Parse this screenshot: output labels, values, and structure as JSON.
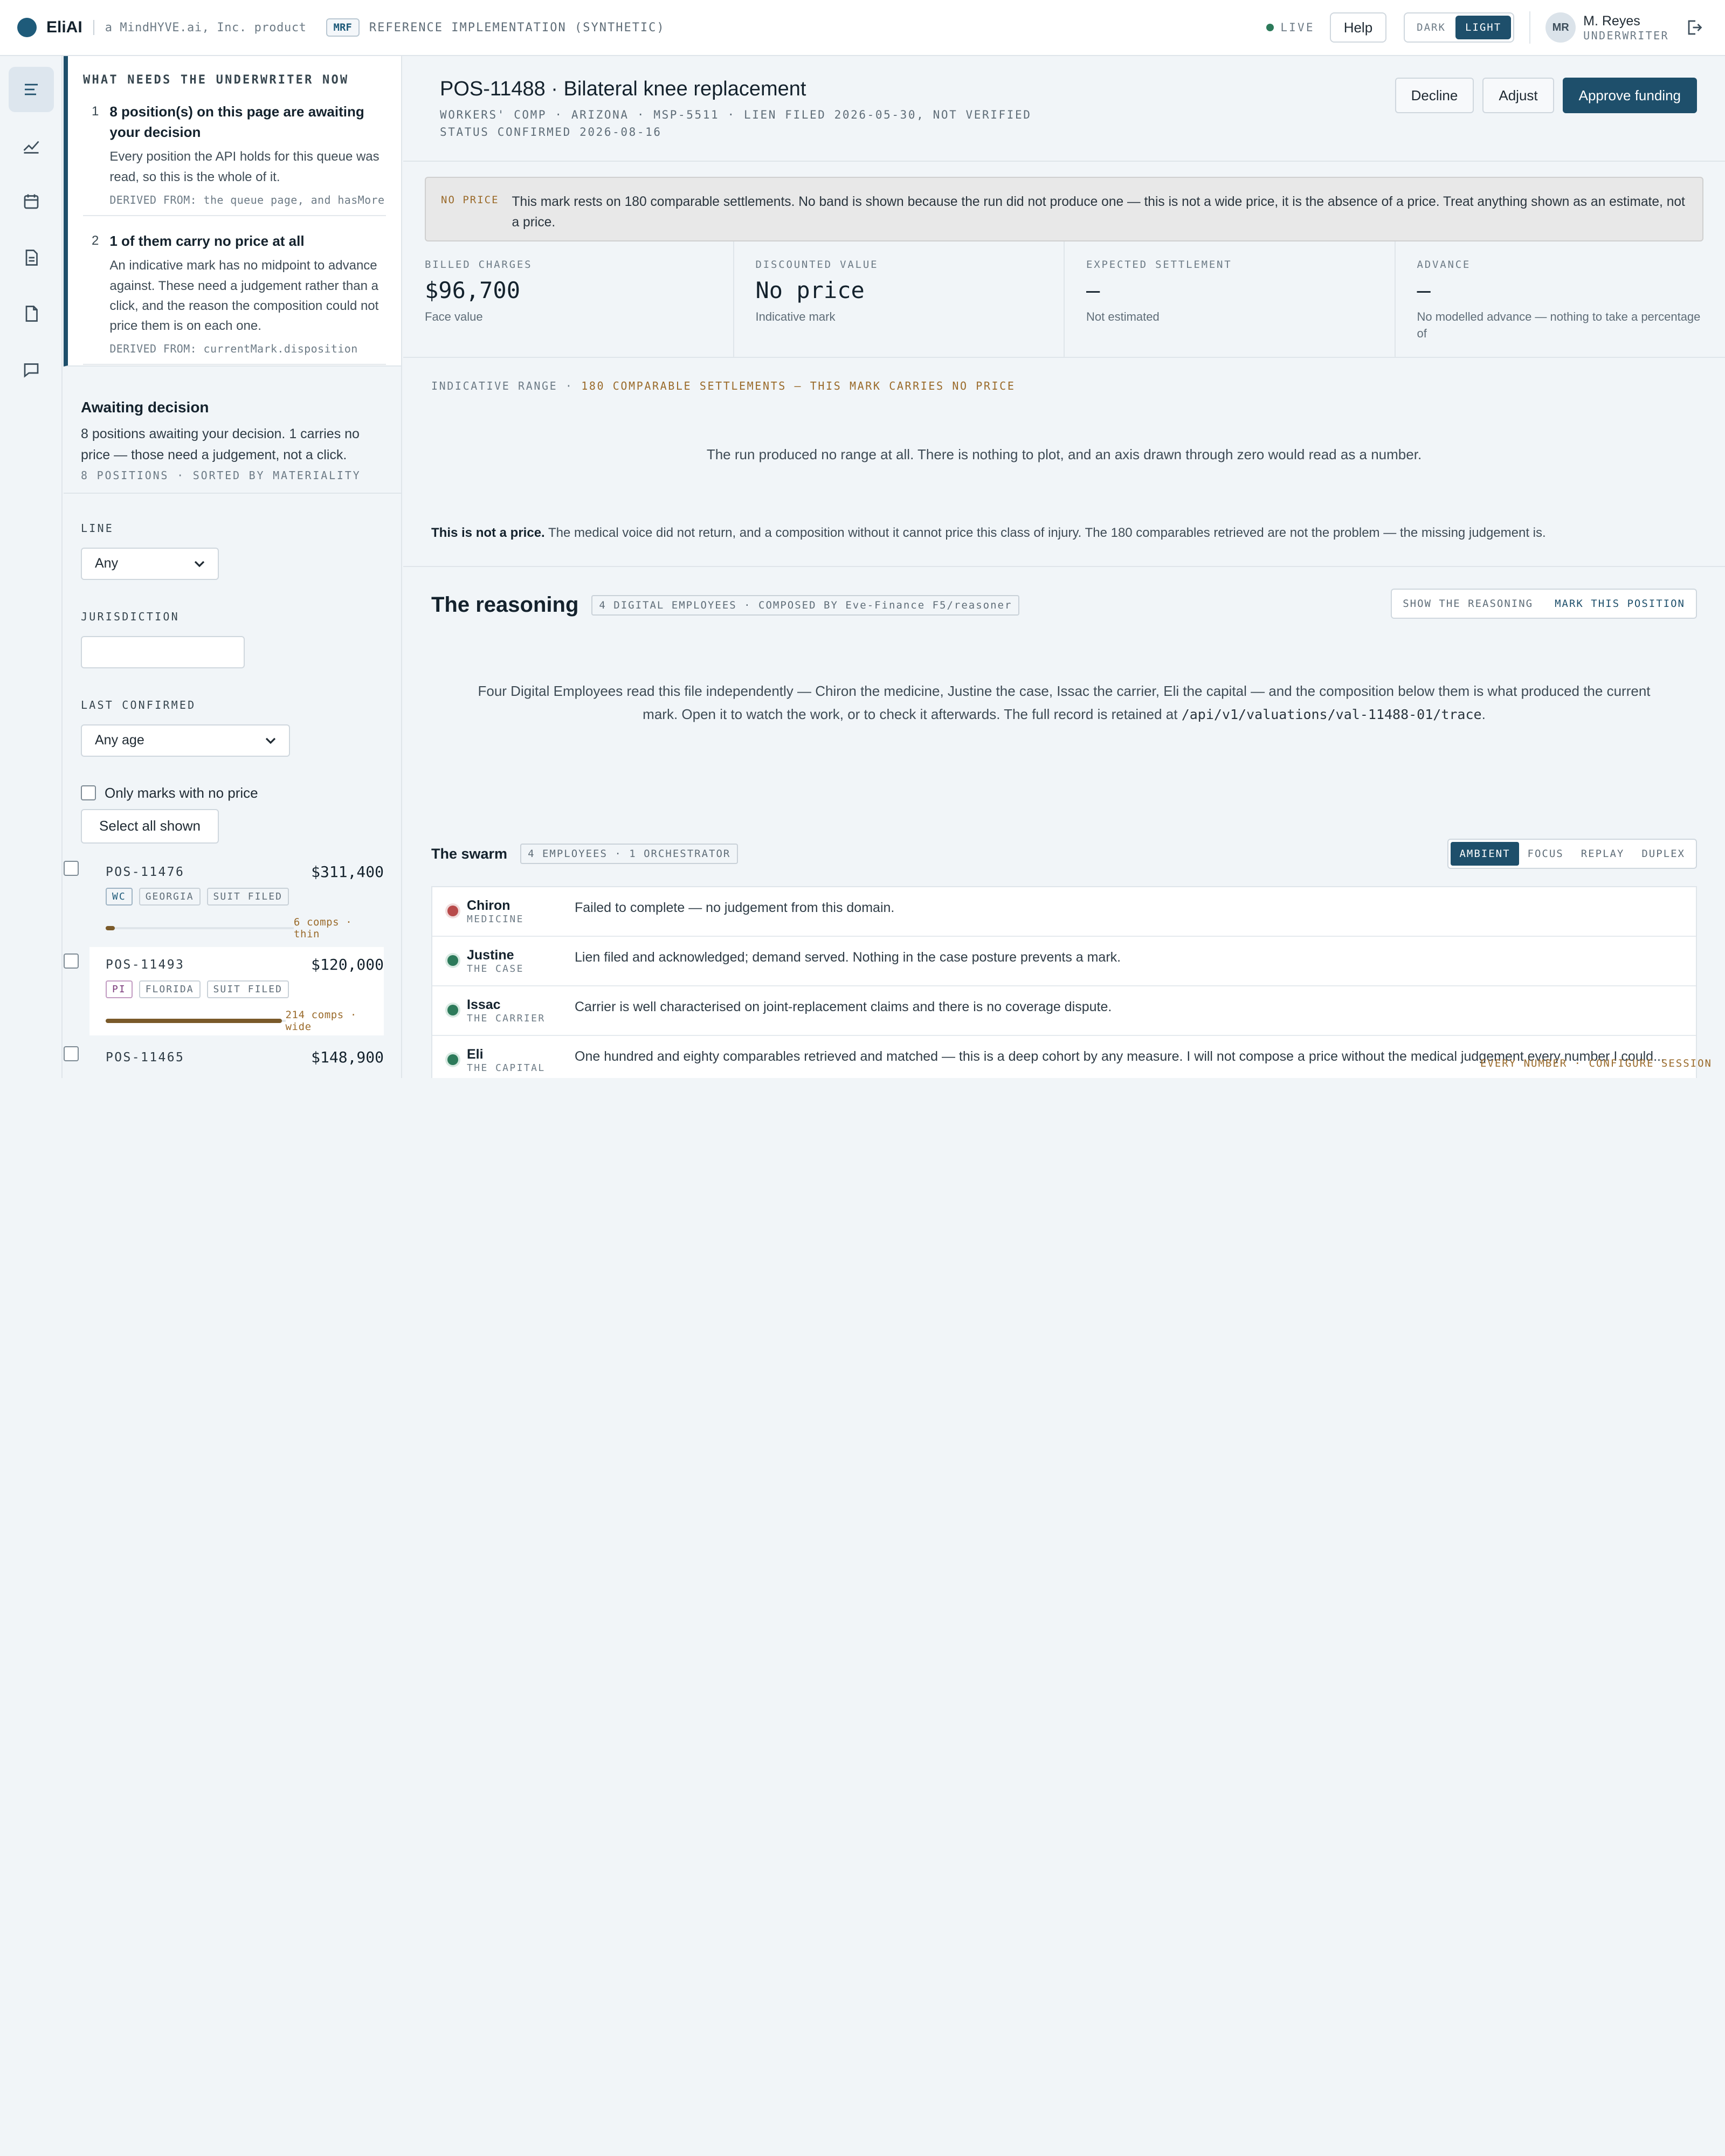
{
  "topbar": {
    "brand": "EliAI",
    "brand_sub": "a MindHYVE.ai, Inc. product",
    "mrf": "MRF",
    "ref": "REFERENCE IMPLEMENTATION (SYNTHETIC)",
    "live": "LIVE",
    "help": "Help",
    "theme_dark": "DARK",
    "theme_light": "LIGHT",
    "avatar": "MR",
    "user_name": "M. Reyes",
    "user_role": "UNDERWRITER"
  },
  "needs": {
    "title": "WHAT NEEDS THE UNDERWRITER NOW",
    "items": [
      {
        "num": "1",
        "head": "8 position(s) on this page are awaiting your decision",
        "body": "Every position the API holds for this queue was read, so this is the whole of it.",
        "derived": "DERIVED FROM: the queue page, and hasMore"
      },
      {
        "num": "2",
        "head": "1 of them carry no price at all",
        "body": "An indicative mark has no midpoint to advance against. These need a judgement rather than a click, and the reason the composition could not price them is on each one.",
        "derived": "DERIVED FROM: currentMark.disposition"
      }
    ]
  },
  "awaiting": {
    "title": "Awaiting decision",
    "body": "8 positions awaiting your decision. 1 carries no price — those need a judgement, not a click.",
    "meta": "8 POSITIONS · SORTED BY MATERIALITY"
  },
  "filters": {
    "line_label": "LINE",
    "line_value": "Any",
    "jurisdiction_label": "JURISDICTION",
    "jurisdiction_value": "",
    "confirmed_label": "LAST CONFIRMED",
    "confirmed_value": "Any age",
    "no_price_label": "Only marks with no price",
    "select_all": "Select all shown"
  },
  "positions": [
    {
      "id": "POS-11476",
      "value": "$311,400",
      "tags": [
        "WC",
        "GEORGIA",
        "SUIT FILED"
      ],
      "comps_fraction": 0.05,
      "note": "6 comps · thin"
    },
    {
      "id": "POS-11493",
      "value": "$120,000",
      "tags": [
        "PI",
        "FLORIDA",
        "SUIT FILED"
      ],
      "comps_fraction": 0.98,
      "note": "214 comps · wide"
    },
    {
      "id": "POS-11465",
      "value": "$148,900",
      "tags": [],
      "comps_fraction": 0,
      "note": ""
    }
  ],
  "header": {
    "title": "POS-11488 · Bilateral knee replacement",
    "subline": "WORKERS' COMP · ARIZONA · MSP-5511 · LIEN FILED 2026-05-30, NOT VERIFIED",
    "subline2": "STATUS CONFIRMED 2026-08-16",
    "decline": "Decline",
    "adjust": "Adjust",
    "approve": "Approve funding"
  },
  "notice": {
    "tag": "NO PRICE",
    "text": "This mark rests on 180 comparable settlements. No band is shown because the run did not produce one — this is not a wide price, it is the absence of a price. Treat anything shown as an estimate, not a price."
  },
  "kpis": [
    {
      "label": "BILLED CHARGES",
      "value": "$96,700",
      "sub": "Face value"
    },
    {
      "label": "DISCOUNTED VALUE",
      "value": "No price",
      "sub": "Indicative mark"
    },
    {
      "label": "EXPECTED SETTLEMENT",
      "value": "—",
      "sub": "Not estimated"
    },
    {
      "label": "ADVANCE",
      "value": "—",
      "sub": "No modelled advance — nothing to take a percentage of"
    }
  ],
  "range": {
    "label": "INDICATIVE RANGE ·",
    "label_accent": "180 COMPARABLE SETTLEMENTS — THIS MARK CARRIES NO PRICE",
    "empty": "The run produced no range at all. There is nothing to plot, and an axis drawn through zero would read as a number.",
    "note_bold": "This is not a price.",
    "note": "The medical voice did not return, and a composition without it cannot price this class of injury. The 180 comparables retrieved are not the problem — the missing judgement is."
  },
  "reasoning": {
    "title": "The reasoning",
    "pill": "4 DIGITAL EMPLOYEES · COMPOSED BY Eve-Finance F5/reasoner",
    "show": "SHOW THE REASONING",
    "mark": "MARK THIS POSITION",
    "body": "Four Digital Employees read this file independently — Chiron the medicine, Justine the case, Issac the carrier, Eli the capital — and the composition below them is what produced the current mark. Open it to watch the work, or to check it afterwards. The full record is retained at",
    "path": "/api/v1/valuations/val-11488-01/trace",
    "body_end": "."
  },
  "swarm": {
    "title": "The swarm",
    "pill": "4 EMPLOYEES · 1 ORCHESTRATOR",
    "modes": [
      "AMBIENT",
      "FOCUS",
      "REPLAY",
      "DUPLEX"
    ],
    "agents": [
      {
        "name": "Chiron",
        "role": "MEDICINE",
        "status": "failed",
        "text": "Failed to complete — no judgement from this domain."
      },
      {
        "name": "Justine",
        "role": "THE CASE",
        "status": "ok",
        "text": "Lien filed and acknowledged; demand served. Nothing in the case posture prevents a mark."
      },
      {
        "name": "Issac",
        "role": "THE CARRIER",
        "status": "ok",
        "text": "Carrier is well characterised on joint-replacement claims and there is no coverage dispute."
      },
      {
        "name": "Eli",
        "role": "THE CAPITAL",
        "status": "ok",
        "text": "One hundred and eighty comparables retrieved and matched — this is a deep cohort by any measure. I will not compose a price without the medical judgement every number I could..."
      }
    ],
    "overlay": "EVERY NUMBER · CONFIGURE SESSION"
  }
}
